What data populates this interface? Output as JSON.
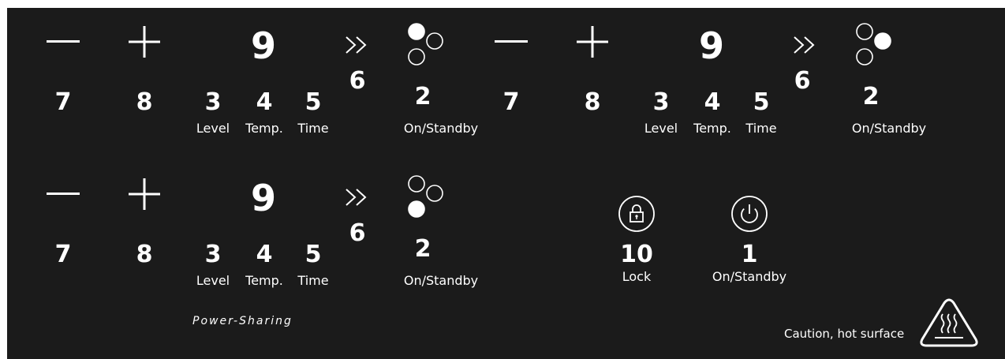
{
  "zones": [
    {
      "id": "front-left",
      "minus_number": "7",
      "plus_number": "8",
      "display_number": "9",
      "boost_number": "6",
      "standby_number": "2",
      "standby_label": "On/Standby",
      "level_number": "3",
      "level_label": "Level",
      "temp_number": "4",
      "temp_label": "Temp.",
      "time_number": "5",
      "time_label": "Time",
      "indicator_filled": "top-left"
    },
    {
      "id": "front-right",
      "minus_number": "7",
      "plus_number": "8",
      "display_number": "9",
      "boost_number": "6",
      "standby_number": "2",
      "standby_label": "On/Standby",
      "level_number": "3",
      "level_label": "Level",
      "temp_number": "4",
      "temp_label": "Temp.",
      "time_number": "5",
      "time_label": "Time",
      "indicator_filled": "top-right"
    },
    {
      "id": "rear",
      "minus_number": "7",
      "plus_number": "8",
      "display_number": "9",
      "boost_number": "6",
      "standby_number": "2",
      "standby_label": "On/Standby",
      "level_number": "3",
      "level_label": "Level",
      "temp_number": "4",
      "temp_label": "Temp.",
      "time_number": "5",
      "time_label": "Time",
      "indicator_filled": "bottom-left"
    }
  ],
  "lock": {
    "number": "10",
    "label": "Lock",
    "icon": "padlock-icon"
  },
  "main_power": {
    "number": "1",
    "label": "On/Standby",
    "icon": "power-icon"
  },
  "power_sharing_label": "Power-Sharing",
  "caution": {
    "label": "Caution, hot surface",
    "icon": "hot-surface-warning-icon"
  },
  "colors": {
    "panel": "#1b1b1b",
    "foreground": "#ffffff"
  }
}
